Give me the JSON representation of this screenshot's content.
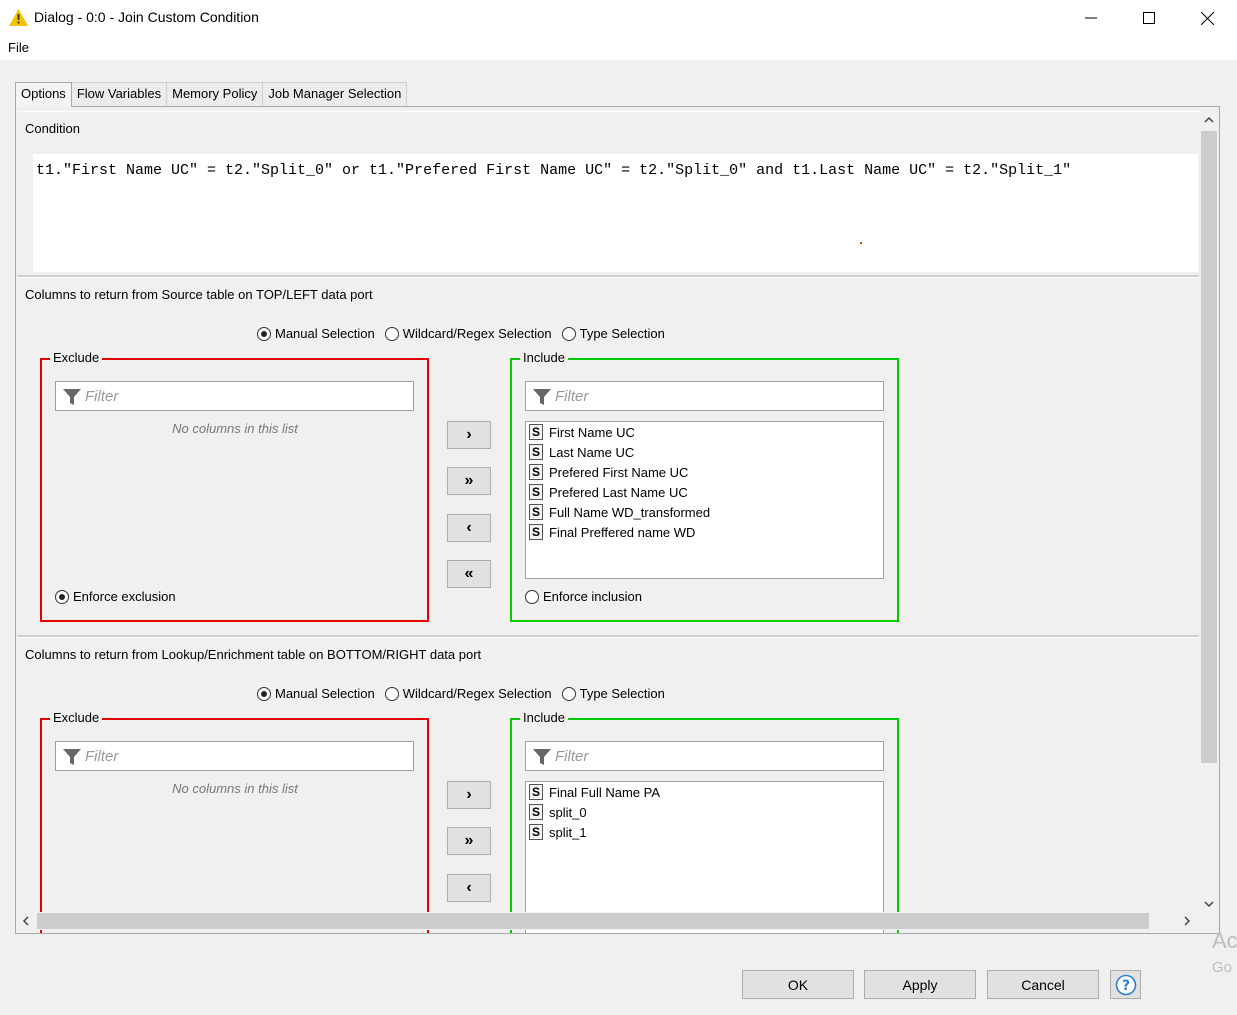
{
  "window": {
    "title": "Dialog - 0:0 - Join Custom Condition",
    "minimize_label": "—",
    "maximize_label": "☐",
    "close_label": "✕"
  },
  "menu": {
    "file": "File"
  },
  "tabs": [
    {
      "label": "Options",
      "active": true
    },
    {
      "label": "Flow Variables"
    },
    {
      "label": "Memory Policy"
    },
    {
      "label": "Job Manager Selection"
    }
  ],
  "condition": {
    "title": "Condition",
    "text": "t1.\"First Name UC\" = t2.\"Split_0\" or t1.\"Prefered First Name UC\" = t2.\"Split_0\" and t1.Last Name UC\" = t2.\"Split_1\""
  },
  "source": {
    "title": "Columns to return from Source table on TOP/LEFT data port",
    "modes": [
      "Manual Selection",
      "Wildcard/Regex Selection",
      "Type Selection"
    ],
    "selected_mode": "Manual Selection",
    "exclude": {
      "label": "Exclude",
      "filter_placeholder": "Filter",
      "empty_text": "No columns in this list",
      "enforce_label": "Enforce exclusion",
      "enforce_checked": true
    },
    "include": {
      "label": "Include",
      "filter_placeholder": "Filter",
      "type_badge": "S",
      "items": [
        "First Name UC",
        "Last Name UC",
        "Prefered First Name UC",
        "Prefered Last Name UC",
        "Full Name WD_transformed",
        "Final Preffered name WD"
      ],
      "enforce_label": "Enforce inclusion",
      "enforce_checked": false
    }
  },
  "lookup": {
    "title": "Columns to return from Lookup/Enrichment table on BOTTOM/RIGHT data port",
    "modes": [
      "Manual Selection",
      "Wildcard/Regex Selection",
      "Type Selection"
    ],
    "selected_mode": "Manual Selection",
    "exclude": {
      "label": "Exclude",
      "filter_placeholder": "Filter",
      "empty_text": "No columns in this list"
    },
    "include": {
      "label": "Include",
      "filter_placeholder": "Filter",
      "type_badge": "S",
      "items": [
        "Final Full Name PA",
        "split_0",
        "split_1"
      ]
    }
  },
  "move_buttons": {
    "add": "›",
    "add_all": "»",
    "remove": "‹",
    "remove_all": "«"
  },
  "buttons": {
    "ok": "OK",
    "apply": "Apply",
    "cancel": "Cancel"
  },
  "watermark": {
    "line1": "Ac",
    "line2": "Go"
  }
}
